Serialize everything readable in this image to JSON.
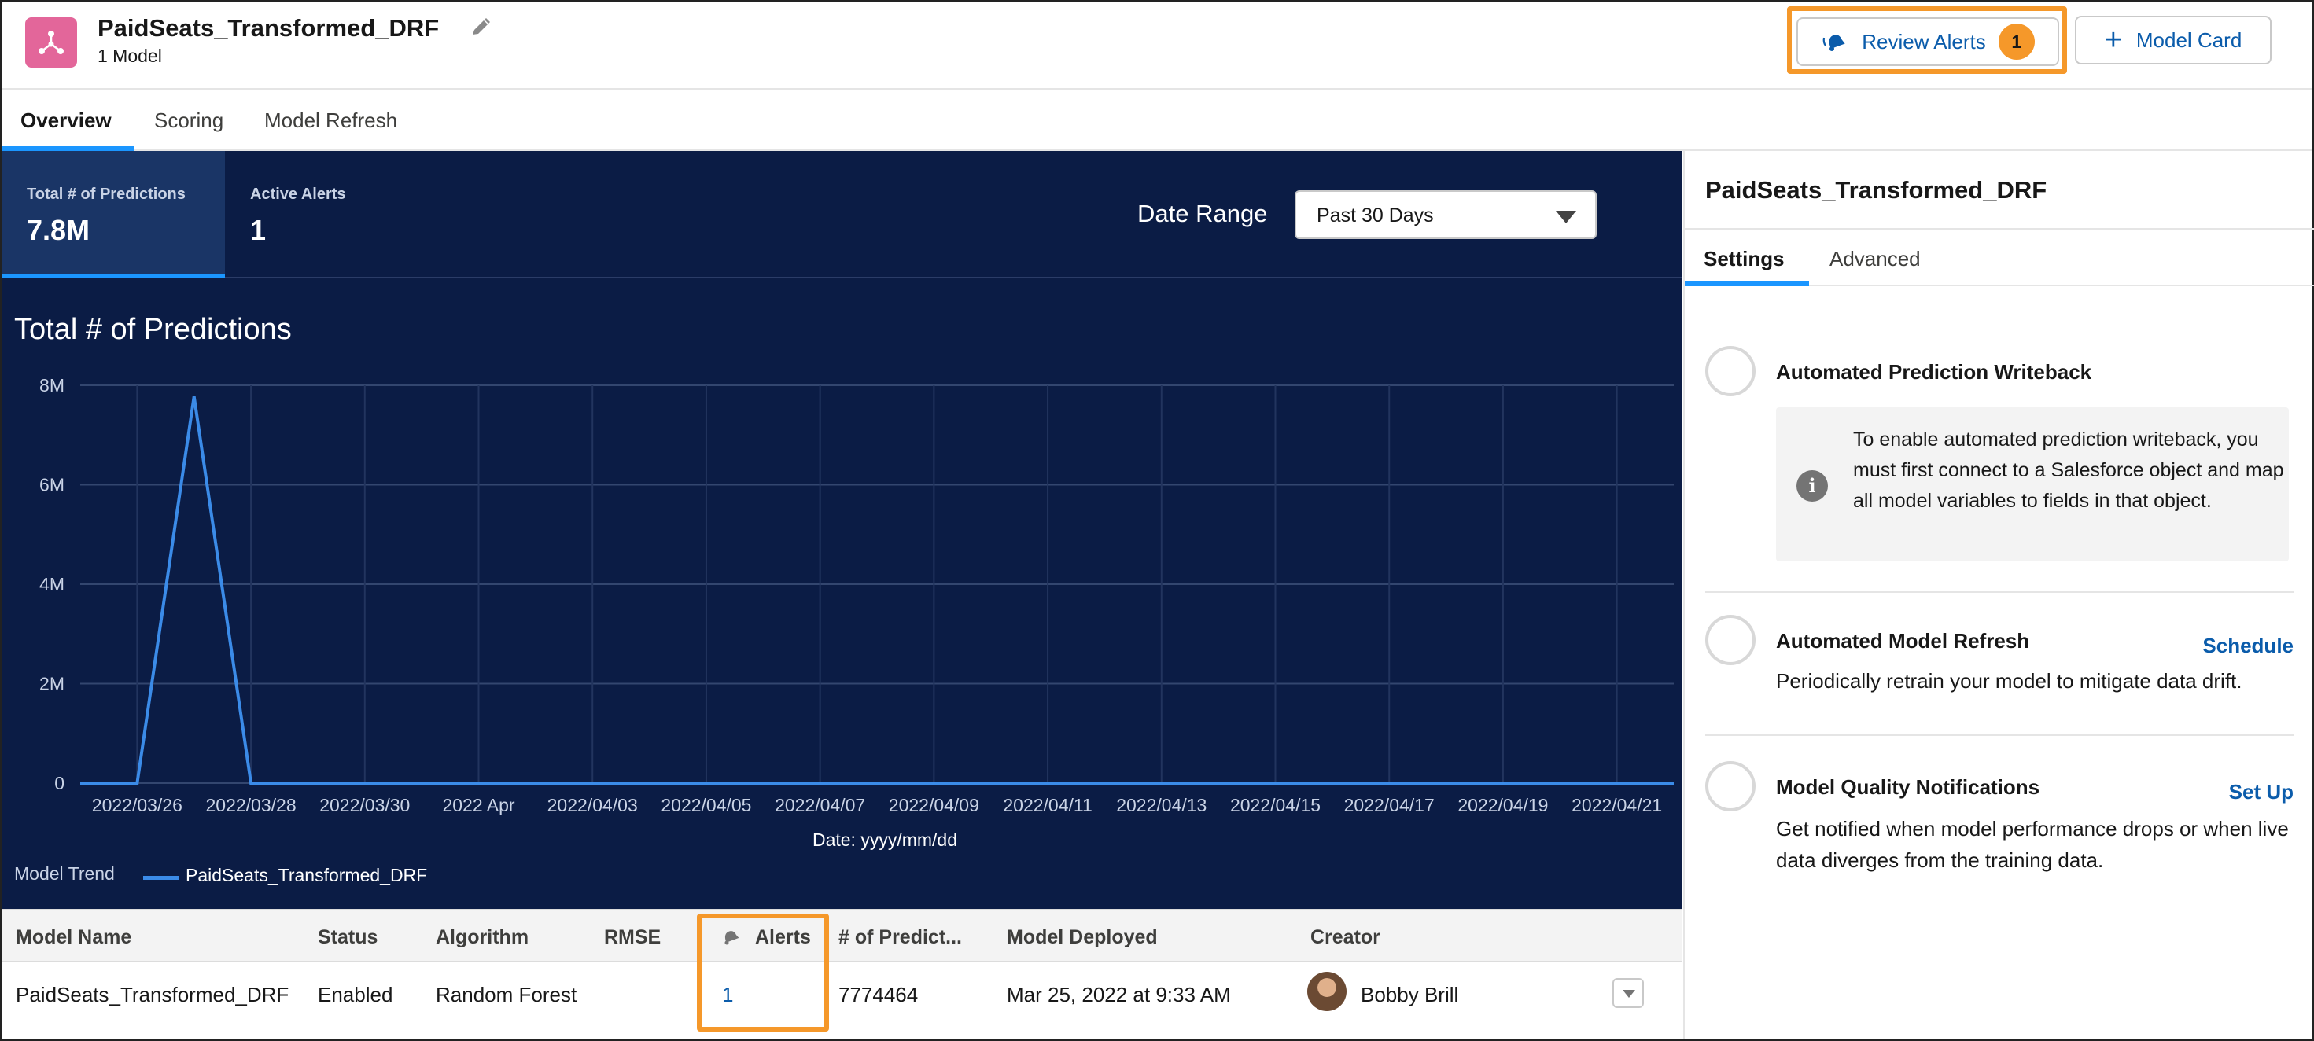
{
  "header": {
    "title": "PaidSeats_Transformed_DRF",
    "subtitle": "1 Model",
    "review_alerts_label": "Review Alerts",
    "review_alerts_count": "1",
    "model_card_label": "Model Card"
  },
  "tabs": [
    {
      "label": "Overview"
    },
    {
      "label": "Scoring"
    },
    {
      "label": "Model Refresh"
    }
  ],
  "kpis": {
    "predictions_label": "Total # of Predictions",
    "predictions_value": "7.8M",
    "alerts_label": "Active Alerts",
    "alerts_value": "1"
  },
  "date_range": {
    "label": "Date Range",
    "value": "Past 30 Days"
  },
  "chart_data": {
    "type": "line",
    "title": "Total # of Predictions",
    "xlabel": "Date: yyyy/mm/dd",
    "ylabel": "",
    "ylim": [
      0,
      8000000
    ],
    "y_ticks": [
      "0",
      "2M",
      "4M",
      "6M",
      "8M"
    ],
    "x_ticks": [
      "2022/03/26",
      "2022/03/28",
      "2022/03/30",
      "2022 Apr",
      "2022/04/03",
      "2022/04/05",
      "2022/04/07",
      "2022/04/09",
      "2022/04/11",
      "2022/04/13",
      "2022/04/15",
      "2022/04/17",
      "2022/04/19",
      "2022/04/21"
    ],
    "legend_title": "Model Trend",
    "legend_position": "bottom-left",
    "grid": true,
    "series": [
      {
        "name": "PaidSeats_Transformed_DRF",
        "color": "#3b8be8",
        "x": [
          "2022/03/25",
          "2022/03/26",
          "2022/03/27",
          "2022/03/28",
          "2022/03/29",
          "2022/03/30",
          "2022/03/31",
          "2022/04/01",
          "2022/04/02",
          "2022/04/03",
          "2022/04/04",
          "2022/04/05",
          "2022/04/06",
          "2022/04/07",
          "2022/04/08",
          "2022/04/09",
          "2022/04/10",
          "2022/04/11",
          "2022/04/12",
          "2022/04/13",
          "2022/04/14",
          "2022/04/15",
          "2022/04/16",
          "2022/04/17",
          "2022/04/18",
          "2022/04/19",
          "2022/04/20",
          "2022/04/21",
          "2022/04/22"
        ],
        "values": [
          0,
          0,
          7774464,
          0,
          0,
          0,
          0,
          0,
          0,
          0,
          0,
          0,
          0,
          0,
          0,
          0,
          0,
          0,
          0,
          0,
          0,
          0,
          0,
          0,
          0,
          0,
          0,
          0,
          0
        ]
      }
    ]
  },
  "table": {
    "headers": [
      "Model Name",
      "Status",
      "Algorithm",
      "RMSE",
      "Alerts",
      "# of Predict...",
      "Model Deployed",
      "Creator"
    ],
    "rows": [
      {
        "model_name": "PaidSeats_Transformed_DRF",
        "status": "Enabled",
        "algorithm": "Random Forest",
        "rmse": "",
        "alerts": "1",
        "predictions": "7774464",
        "deployed": "Mar 25, 2022 at 9:33 AM",
        "creator": "Bobby Brill"
      }
    ]
  },
  "right_panel": {
    "title": "PaidSeats_Transformed_DRF",
    "tabs": [
      "Settings",
      "Advanced"
    ],
    "settings": [
      {
        "title": "Automated Prediction Writeback",
        "info": "To enable automated prediction writeback, you must first connect to a Salesforce object and map all model variables to fields in that object."
      },
      {
        "title": "Automated Model Refresh",
        "link": "Schedule",
        "description": "Periodically retrain your model to mitigate data drift."
      },
      {
        "title": "Model Quality Notifications",
        "link": "Set Up",
        "description": "Get notified when model performance drops or when live data diverges from the training data."
      }
    ]
  },
  "colors": {
    "accent": "#1b96ff",
    "link": "#0b5cab",
    "highlight": "#f5982a",
    "panel_dark": "#0b1c45",
    "app_icon": "#e3669a"
  }
}
